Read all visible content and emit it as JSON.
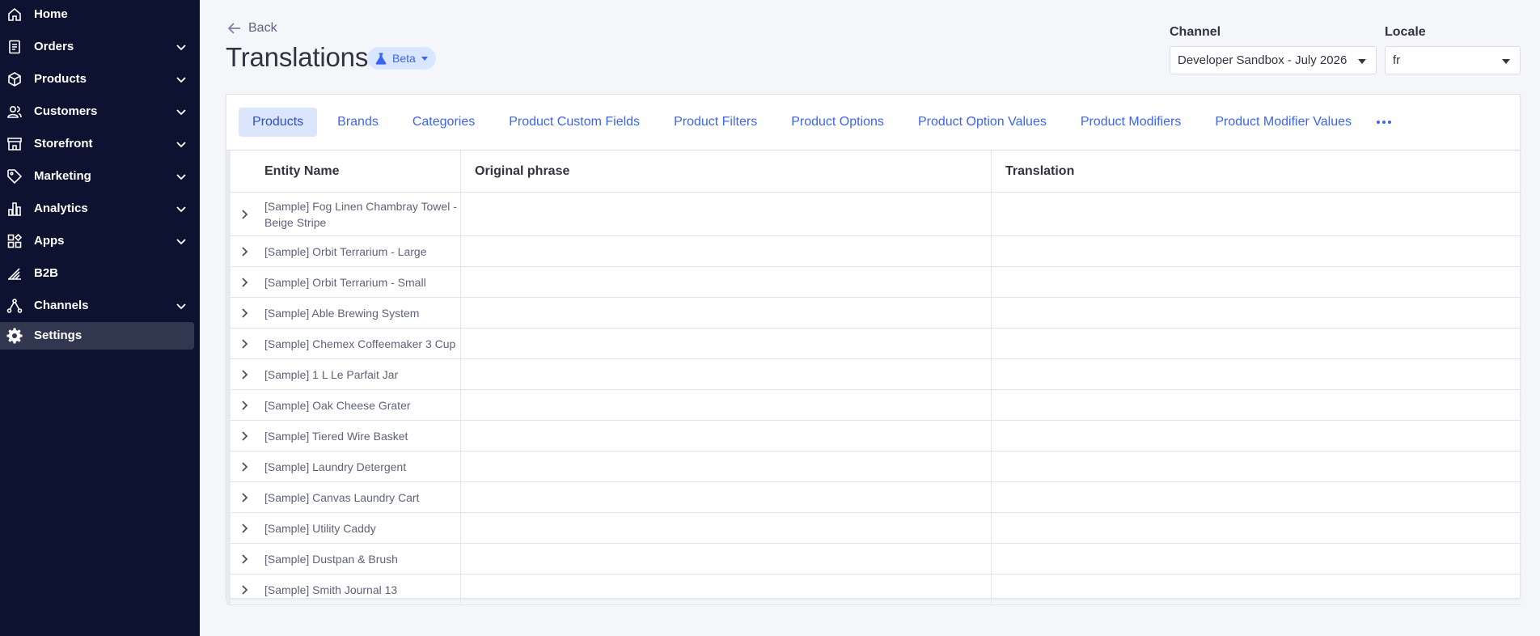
{
  "sidebar": {
    "items": [
      {
        "label": "Home",
        "icon": "home-icon",
        "has_chevron": false,
        "active": false
      },
      {
        "label": "Orders",
        "icon": "orders-icon",
        "has_chevron": true,
        "active": false
      },
      {
        "label": "Products",
        "icon": "products-icon",
        "has_chevron": true,
        "active": false
      },
      {
        "label": "Customers",
        "icon": "customers-icon",
        "has_chevron": true,
        "active": false
      },
      {
        "label": "Storefront",
        "icon": "storefront-icon",
        "has_chevron": true,
        "active": false
      },
      {
        "label": "Marketing",
        "icon": "tag-icon",
        "has_chevron": true,
        "active": false
      },
      {
        "label": "Analytics",
        "icon": "analytics-icon",
        "has_chevron": true,
        "active": false
      },
      {
        "label": "Apps",
        "icon": "apps-icon",
        "has_chevron": true,
        "active": false
      },
      {
        "label": "B2B",
        "icon": "b2b-icon",
        "has_chevron": false,
        "active": false
      },
      {
        "label": "Channels",
        "icon": "channels-icon",
        "has_chevron": true,
        "active": false
      },
      {
        "label": "Settings",
        "icon": "gear-icon",
        "has_chevron": false,
        "active": true
      }
    ]
  },
  "header": {
    "back_label": "Back",
    "title": "Translations",
    "beta_label": "Beta"
  },
  "filters": {
    "channel_label": "Channel",
    "channel_value": "Developer Sandbox - July 2026",
    "locale_label": "Locale",
    "locale_value": "fr"
  },
  "tabs": [
    {
      "label": "Products",
      "active": true
    },
    {
      "label": "Brands",
      "active": false
    },
    {
      "label": "Categories",
      "active": false
    },
    {
      "label": "Product Custom Fields",
      "active": false
    },
    {
      "label": "Product Filters",
      "active": false
    },
    {
      "label": "Product Options",
      "active": false
    },
    {
      "label": "Product Option Values",
      "active": false
    },
    {
      "label": "Product Modifiers",
      "active": false
    },
    {
      "label": "Product Modifier Values",
      "active": false
    }
  ],
  "table": {
    "columns": [
      "Entity Name",
      "Original phrase",
      "Translation"
    ],
    "rows": [
      {
        "entity": "[Sample] Fog Linen Chambray Towel - Beige Stripe",
        "original": "",
        "translation": ""
      },
      {
        "entity": "[Sample] Orbit Terrarium - Large",
        "original": "",
        "translation": ""
      },
      {
        "entity": "[Sample] Orbit Terrarium - Small",
        "original": "",
        "translation": ""
      },
      {
        "entity": "[Sample] Able Brewing System",
        "original": "",
        "translation": ""
      },
      {
        "entity": "[Sample] Chemex Coffeemaker 3 Cup",
        "original": "",
        "translation": ""
      },
      {
        "entity": "[Sample] 1 L Le Parfait Jar",
        "original": "",
        "translation": ""
      },
      {
        "entity": "[Sample] Oak Cheese Grater",
        "original": "",
        "translation": ""
      },
      {
        "entity": "[Sample] Tiered Wire Basket",
        "original": "",
        "translation": ""
      },
      {
        "entity": "[Sample] Laundry Detergent",
        "original": "",
        "translation": ""
      },
      {
        "entity": "[Sample] Canvas Laundry Cart",
        "original": "",
        "translation": ""
      },
      {
        "entity": "[Sample] Utility Caddy",
        "original": "",
        "translation": ""
      },
      {
        "entity": "[Sample] Dustpan & Brush",
        "original": "",
        "translation": ""
      },
      {
        "entity": "[Sample] Smith Journal 13",
        "original": "",
        "translation": ""
      }
    ]
  },
  "colors": {
    "sidebar_bg": "#0d1230",
    "accent": "#3c64f4",
    "active_tab_bg": "#dbe5fc"
  }
}
